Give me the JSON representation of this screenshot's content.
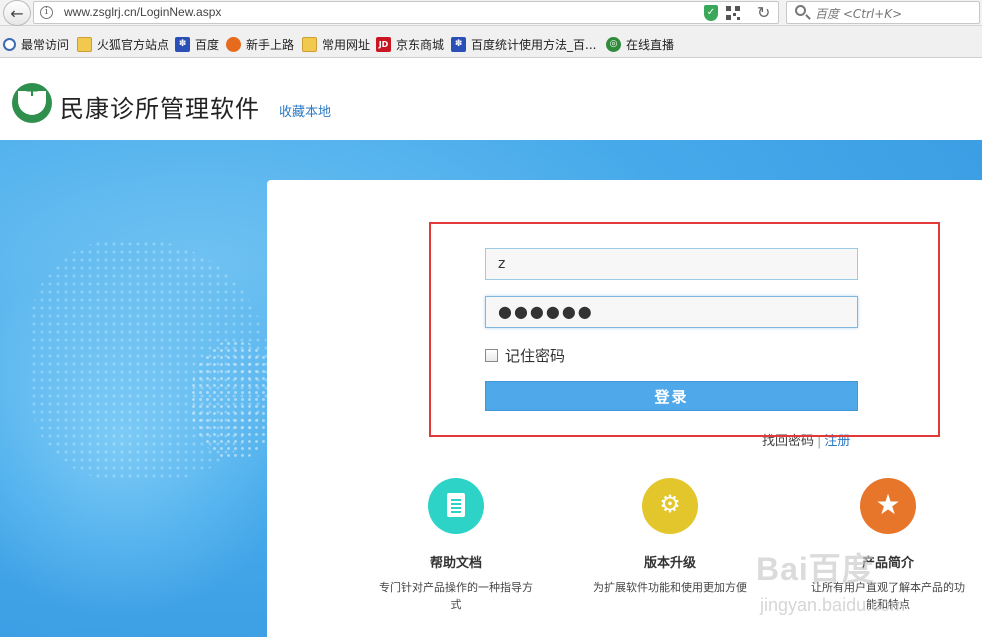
{
  "browser": {
    "url": "www.zsglrj.cn/LoginNew.aspx",
    "search_placeholder": "百度 <Ctrl+K>"
  },
  "bookmarks": [
    {
      "label": "最常访问",
      "icon": "most-visited-icon"
    },
    {
      "label": "火狐官方站点",
      "icon": "folder-icon"
    },
    {
      "label": "百度",
      "icon": "baidu-paw-icon"
    },
    {
      "label": "新手上路",
      "icon": "firefox-icon"
    },
    {
      "label": "常用网址",
      "icon": "folder-icon"
    },
    {
      "label": "京东商城",
      "icon": "jd-icon"
    },
    {
      "label": "百度统计使用方法_百...",
      "icon": "baidu-paw-icon"
    },
    {
      "label": "在线直播",
      "icon": "live-icon"
    }
  ],
  "header": {
    "site_title": "民康诊所管理软件",
    "bookmark_link": "收藏本地"
  },
  "login": {
    "username_value": "z",
    "password_value": "●●●●●●",
    "remember_label": "记住密码",
    "login_button": "登录",
    "forgot_link": "找回密码",
    "separator": "|",
    "register_link": "注册"
  },
  "features": [
    {
      "title": "帮助文档",
      "desc": "专门针对产品操作的一种指导方式",
      "icon": "document-icon"
    },
    {
      "title": "版本升级",
      "desc": "为扩展软件功能和使用更加方便",
      "icon": "gear-icon"
    },
    {
      "title": "产品简介",
      "desc": "让所有用户直观了解本产品的功能和特点",
      "icon": "star-icon"
    }
  ],
  "watermark": {
    "brand": "Bai百度",
    "sub": "jingyan.baidu.com"
  },
  "colors": {
    "accent": "#4ea8ea",
    "highlight": "#e23a3a",
    "logo_green": "#2f8f4c"
  }
}
